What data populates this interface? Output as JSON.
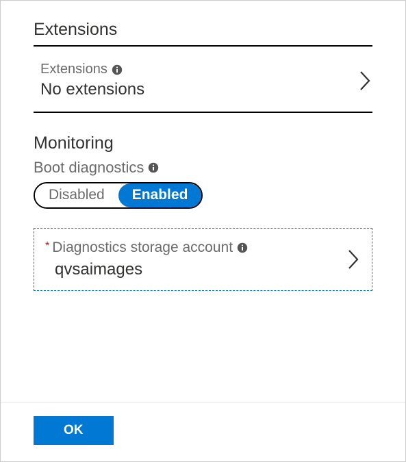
{
  "extensions": {
    "title": "Extensions",
    "row": {
      "label": "Extensions",
      "value": "No extensions"
    }
  },
  "monitoring": {
    "title": "Monitoring",
    "boot_diagnostics": {
      "label": "Boot diagnostics",
      "options": {
        "disabled": "Disabled",
        "enabled": "Enabled"
      },
      "selected": "enabled"
    },
    "storage_account": {
      "label": "Diagnostics storage account",
      "value": "qvsaimages",
      "required": true,
      "asterisk": "*"
    }
  },
  "footer": {
    "ok_label": "OK"
  }
}
